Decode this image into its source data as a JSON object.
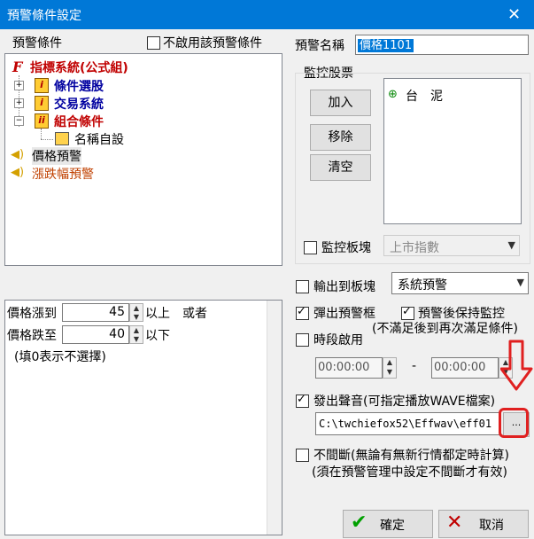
{
  "window": {
    "title": "預警條件設定",
    "close_glyph": "✕"
  },
  "left_header": {
    "label": "預警條件",
    "disable_checkbox_label": "不啟用該預警條件",
    "disable_checked": false
  },
  "tree": {
    "root": "指標系統(公式組)",
    "items": [
      {
        "label": "條件選股"
      },
      {
        "label": "交易系統"
      },
      {
        "label": "組合條件"
      }
    ],
    "sub_item": "名稱自設",
    "price_alert": "價格預警",
    "limit_alert": "漲跌幅預警"
  },
  "price_panel": {
    "rise_label": "價格漲到",
    "rise_value": "45",
    "rise_suffix": "以上",
    "or_text": "或者",
    "fall_label": "價格跌至",
    "fall_value": "40",
    "fall_suffix": "以下",
    "note": "(填0表示不選擇)"
  },
  "right": {
    "name_label": "預警名稱",
    "name_value": "價格1101",
    "monitor_group": "監控股票",
    "add_button": "加入",
    "remove_button": "移除",
    "clear_button": "清空",
    "stock_list": [
      "台　泥"
    ],
    "monitor_board_label": "監控板塊",
    "monitor_board_checked": false,
    "board_combo_value": "上市指數",
    "output_label": "輸出到板塊",
    "output_checked": false,
    "output_combo_value": "系統預警",
    "popup_label": "彈出預警框",
    "popup_checked": true,
    "keep_label": "預警後保持監控",
    "keep_checked": true,
    "keep_note": "(不滿足後到再次滿足條件)",
    "period_label": "時段啟用",
    "period_checked": false,
    "time_start": "00:00:00",
    "time_dash": "-",
    "time_end": "00:00:00",
    "sound_label": "發出聲音(可指定播放WAVE檔案)",
    "sound_checked": true,
    "sound_path": "C:\\twchiefox52\\Effwav\\eff01",
    "browse_button": "...",
    "continuous_label": "不間斷(無論有無新行情都定時計算)",
    "continuous_checked": false,
    "continuous_note": "(須在預警管理中設定不間斷才有效)",
    "ok_button": "確定",
    "cancel_button": "取消"
  },
  "colors": {
    "title_bar": "#0078d7",
    "highlight": "#e02020",
    "ok_check": "#00a000",
    "cancel_x": "#c00000"
  }
}
